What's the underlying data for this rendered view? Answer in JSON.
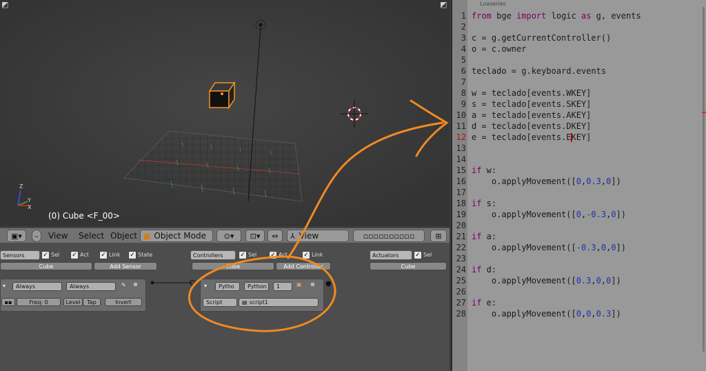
{
  "viewport": {
    "object_label": "(0) Cube <F_00>",
    "axis_labels": {
      "z": "Z",
      "y": "Y",
      "x": "X"
    }
  },
  "viewport_header": {
    "menus": [
      "View",
      "Select",
      "Object"
    ],
    "mode_label": "Object Mode",
    "view_label": "View"
  },
  "logic": {
    "sensors": {
      "header": "Sensors",
      "checks": [
        "Sel",
        "Act",
        "Link",
        "State"
      ],
      "object": "Cube",
      "add": "Add Sensor",
      "sensor_type": "Always",
      "sensor_name": "Always",
      "freq_label": "Freq: 0",
      "buttons": [
        "Level",
        "Tap",
        "Invert"
      ]
    },
    "controllers": {
      "header": "Controllers",
      "checks": [
        "Sel",
        "Act",
        "Link"
      ],
      "object": "Cube",
      "add": "Add Controller",
      "type": "Pytho",
      "name": "Python",
      "state": "1",
      "mode": "Script",
      "script": "script1"
    },
    "actuators": {
      "header": "Actuators",
      "checks": [
        "Sel"
      ],
      "object": "Cube"
    }
  },
  "editor": {
    "tab_title": "Loaseries",
    "lines": [
      {
        "n": "1",
        "html": "<span class='kw'>from</span> bge <span class='kw'>import</span> logic <span class='kw'>as</span> g, events"
      },
      {
        "n": "2",
        "html": ""
      },
      {
        "n": "3",
        "html": "c = g.getCurrentController()"
      },
      {
        "n": "4",
        "html": "o = c.owner"
      },
      {
        "n": "5",
        "html": ""
      },
      {
        "n": "6",
        "html": "teclado = g.keyboard.events"
      },
      {
        "n": "7",
        "html": ""
      },
      {
        "n": "8",
        "html": "w = teclado[events.WKEY]"
      },
      {
        "n": "9",
        "html": "s = teclado[events.SKEY]"
      },
      {
        "n": "10",
        "html": "a = teclado[events.AKEY]"
      },
      {
        "n": "11",
        "html": "d = teclado[events.DKEY]"
      },
      {
        "n": "12",
        "html": "e = teclado[events.E<span class='cursor'></span>KEY]",
        "err": true
      },
      {
        "n": "13",
        "html": ""
      },
      {
        "n": "14",
        "html": ""
      },
      {
        "n": "15",
        "html": "<span class='kw'>if</span> w:"
      },
      {
        "n": "16",
        "html": "    o.applyMovement([<span class='nm'>0</span>,<span class='nm'>0.3</span>,<span class='nm'>0</span>])"
      },
      {
        "n": "17",
        "html": ""
      },
      {
        "n": "18",
        "html": "<span class='kw'>if</span> s:"
      },
      {
        "n": "19",
        "html": "    o.applyMovement([<span class='nm'>0</span>,<span class='nm'>-0.3</span>,<span class='nm'>0</span>])"
      },
      {
        "n": "20",
        "html": ""
      },
      {
        "n": "21",
        "html": "<span class='kw'>if</span> a:"
      },
      {
        "n": "22",
        "html": "    o.applyMovement([<span class='nm'>-0.3</span>,<span class='nm'>0</span>,<span class='nm'>0</span>])"
      },
      {
        "n": "23",
        "html": ""
      },
      {
        "n": "24",
        "html": "<span class='kw'>if</span> d:"
      },
      {
        "n": "25",
        "html": "    o.applyMovement([<span class='nm'>0.3</span>,<span class='nm'>0</span>,<span class='nm'>0</span>])"
      },
      {
        "n": "26",
        "html": ""
      },
      {
        "n": "27",
        "html": "<span class='kw'>if</span> e:"
      },
      {
        "n": "28",
        "html": "    o.applyMovement([<span class='nm'>0</span>,<span class='nm'>0</span>,<span class='nm'>0.3</span>])"
      }
    ]
  },
  "colors": {
    "annotation_orange": "#f08a24",
    "selection_orange": "#f7931e",
    "keyword": "#7a0058",
    "number": "#1f2fb0"
  }
}
